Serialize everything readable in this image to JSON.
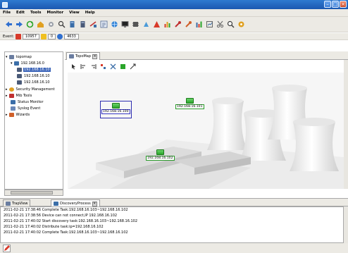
{
  "menu": {
    "items": [
      "File",
      "Edit",
      "Tools",
      "Monitor",
      "View",
      "Help"
    ]
  },
  "eventbar": {
    "label": "Event:",
    "critical_count": "10957",
    "warning_count": "0",
    "info_count": "4633"
  },
  "tree": {
    "items": [
      {
        "label": "topomap",
        "icon": "topomap-icon"
      },
      {
        "label": "192.168.16.0",
        "icon": "subnet-icon"
      },
      {
        "label": "192.168.16.10",
        "icon": "device-icon",
        "selected": true
      },
      {
        "label": "192.168.16.10",
        "icon": "device-icon"
      },
      {
        "label": "192.168.16.10",
        "icon": "device-icon"
      },
      {
        "label": "Security Management",
        "icon": "security-icon"
      },
      {
        "label": "Mib Tools",
        "icon": "mib-tools-icon"
      },
      {
        "label": "Status Monitor",
        "icon": "status-monitor-icon"
      },
      {
        "label": "Syslog Event",
        "icon": "syslog-icon"
      },
      {
        "label": "Wizards",
        "icon": "wizard-icon"
      }
    ]
  },
  "editor_tab": {
    "label": "TopoMap"
  },
  "nodes": [
    {
      "label": "192.168.16.100",
      "selected": true
    },
    {
      "label": "192.168.16.101"
    },
    {
      "label": "192.168.16.102"
    }
  ],
  "bottom_tabs": [
    {
      "label": "TrapView"
    },
    {
      "label": "DiscoveryProcess"
    }
  ],
  "log": [
    "2011-02-21 17:38:46 Complete Task:192.168.16.103~192.168.16.102",
    "2011-02-21 17:38:56 Device can not connect,IP 192.168.16.102",
    "2011-02-21 17:40:02 Start discovery task:192.168.16.103~192.168.16.102",
    "2011-02-21 17:40:02 Distribute task:ip=192.168.16.102",
    "2011-02-21 17:40:02 Complete Task:192.168.16.103~192.168.16.102"
  ],
  "colors": {
    "titlebar": "#1b58b0",
    "selection": "#3a63b8",
    "node_green": "#2aa52a",
    "critical": "#d83a2a",
    "warning": "#f0c020",
    "info": "#2f6fd0"
  }
}
